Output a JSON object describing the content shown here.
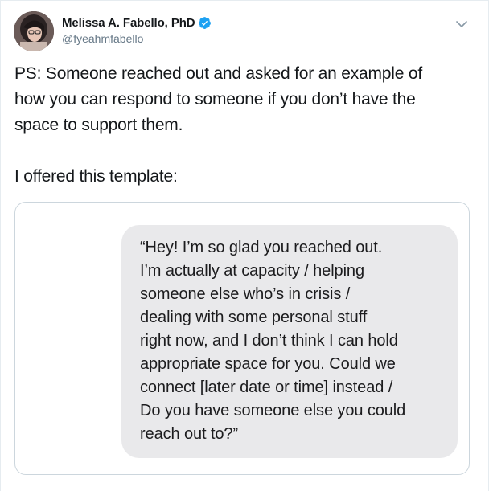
{
  "tweet": {
    "author": {
      "display_name": "Melissa A. Fabello, PhD",
      "handle": "@fyeahmfabello",
      "verified": true,
      "avatar_icon": "profile-photo",
      "verified_icon": "verified-badge-icon",
      "verified_color": "#1da1f2"
    },
    "menu_icon": "chevron-down-icon",
    "text": {
      "lines_p1": [
        "PS: Someone reached out and asked for an example of",
        "how you can respond to someone if you don’t have the",
        "space to support them."
      ],
      "line_p2": "I offered this template:"
    },
    "media": {
      "message_lines": [
        "“Hey! I’m so glad you reached out.",
        "I’m actually at capacity / helping",
        "someone else who’s in crisis /",
        "dealing with some personal stuff",
        "right now, and I don’t think I can hold",
        "appropriate space for you. Could we",
        "connect [later date or time] instead /",
        "Do you have someone else you could",
        "reach out to?”"
      ],
      "bubble_color": "#e9e9eb"
    }
  }
}
